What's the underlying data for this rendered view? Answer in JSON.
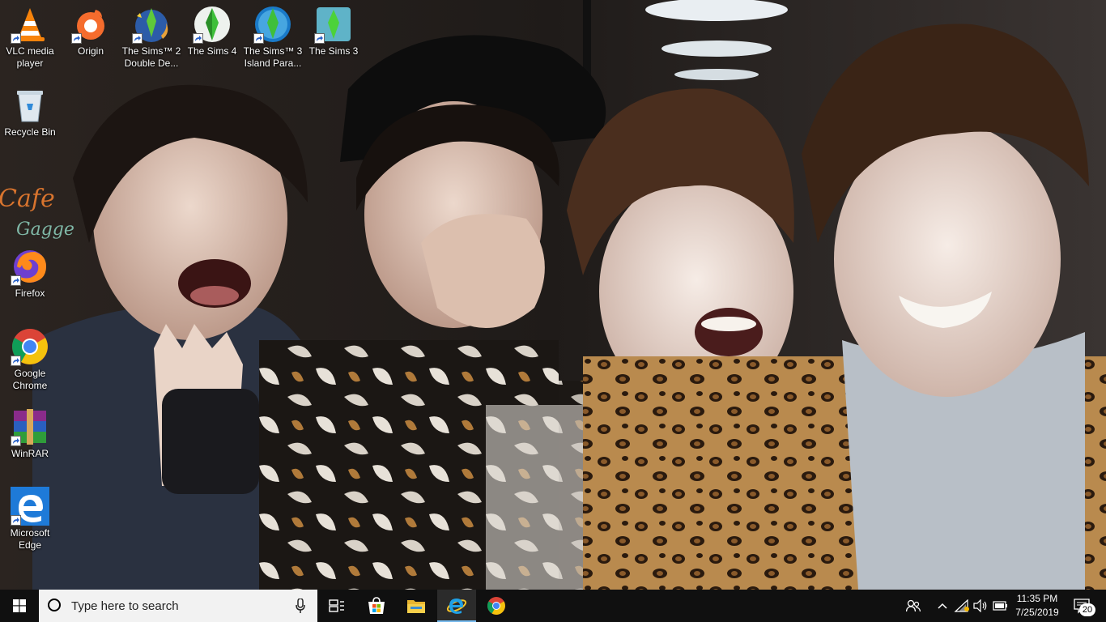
{
  "desktop": {
    "icons": [
      {
        "label": "VLC media player",
        "icon": "vlc-icon"
      },
      {
        "label": "Origin",
        "icon": "origin-icon"
      },
      {
        "label": "The Sims™ 2 Double De...",
        "icon": "sims2-icon"
      },
      {
        "label": "The Sims 4",
        "icon": "sims4-icon"
      },
      {
        "label": "The Sims™ 3 Island Para...",
        "icon": "sims3-island-icon"
      },
      {
        "label": "The Sims 3",
        "icon": "sims3-icon"
      },
      {
        "label": "Recycle Bin",
        "icon": "recycle-bin-icon"
      },
      {
        "label": "Firefox",
        "icon": "firefox-icon"
      },
      {
        "label": "Google Chrome",
        "icon": "chrome-icon"
      },
      {
        "label": "WinRAR",
        "icon": "winrar-icon"
      },
      {
        "label": "Microsoft Edge",
        "icon": "edge-icon"
      }
    ]
  },
  "taskbar": {
    "search_placeholder": "Type here to search",
    "pinned": [
      "task-view",
      "microsoft-store",
      "file-explorer",
      "internet-explorer",
      "google-chrome"
    ],
    "active_app": "internet-explorer",
    "clock_time": "11:35 PM",
    "clock_date": "7/25/2019",
    "notification_count": "20"
  },
  "colors": {
    "taskbar_bg": "#101010",
    "search_bg": "#f2f2f2",
    "accent": "#76b9ed"
  }
}
